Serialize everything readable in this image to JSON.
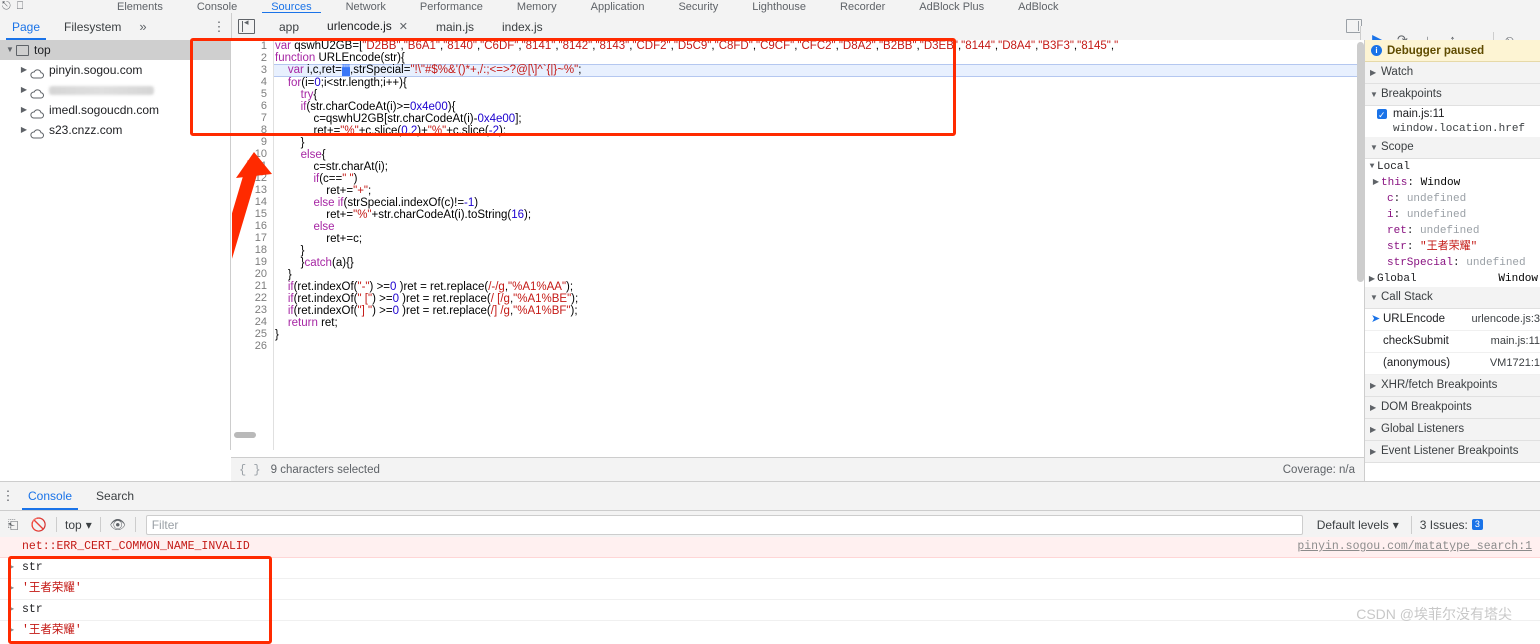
{
  "devtools": {
    "main_tabs": [
      {
        "label": "Elements",
        "active": false
      },
      {
        "label": "Console",
        "active": false
      },
      {
        "label": "Sources",
        "active": true
      },
      {
        "label": "Network",
        "active": false
      },
      {
        "label": "Performance",
        "active": false
      },
      {
        "label": "Memory",
        "active": false
      },
      {
        "label": "Application",
        "active": false
      },
      {
        "label": "Security",
        "active": false
      },
      {
        "label": "Lighthouse",
        "active": false
      },
      {
        "label": "Recorder",
        "active": false
      },
      {
        "label": "AdBlock Plus",
        "active": false
      },
      {
        "label": "AdBlock",
        "active": false
      }
    ],
    "left_icons": [
      "inspect-icon",
      "device-toolbar-icon"
    ]
  },
  "navigator": {
    "tabs": [
      {
        "label": "Page",
        "active": true
      },
      {
        "label": "Filesystem",
        "active": false
      }
    ],
    "more_label": "»",
    "menu_icon": "kebab-menu-icon",
    "tree": [
      {
        "label": "top",
        "icon": "frame-icon",
        "depth": 0,
        "selected": true,
        "expanded": true,
        "blurred": false
      },
      {
        "label": "pinyin.sogou.com",
        "icon": "cloud-icon",
        "depth": 1,
        "selected": false,
        "expanded": false,
        "blurred": false
      },
      {
        "label": "",
        "icon": "cloud-icon",
        "depth": 1,
        "selected": false,
        "expanded": false,
        "blurred": true
      },
      {
        "label": "imedl.sogoucdn.com",
        "icon": "cloud-icon",
        "depth": 1,
        "selected": false,
        "expanded": false,
        "blurred": false
      },
      {
        "label": "s23.cnzz.com",
        "icon": "cloud-icon",
        "depth": 1,
        "selected": false,
        "expanded": false,
        "blurred": false
      }
    ]
  },
  "editor_tabs": {
    "panel_toggle_icon": "show-navigator-icon",
    "items": [
      {
        "label": "app",
        "active": false,
        "closable": false
      },
      {
        "label": "urlencode.js",
        "active": true,
        "closable": true,
        "close_label": "✕"
      },
      {
        "label": "main.js",
        "active": false,
        "closable": false
      },
      {
        "label": "index.js",
        "active": false,
        "closable": false
      }
    ]
  },
  "debug_toolbar": {
    "buttons": [
      {
        "name": "resume-script-execution",
        "glyph": "▶"
      },
      {
        "name": "step-over-next-function-call",
        "glyph": "↷"
      },
      {
        "name": "step-into-next-function-call",
        "glyph": "↓"
      },
      {
        "name": "step-out-of-current-function",
        "glyph": "↑"
      },
      {
        "name": "step",
        "glyph": "→"
      },
      {
        "name": "deactivate-breakpoints",
        "glyph": "⦸"
      }
    ]
  },
  "code": {
    "file": "urlencode.js",
    "highlighted_line": 3,
    "selection": "\"\"",
    "lines": [
      {
        "n": 1,
        "text": "var qswhU2GB=[\"D2BB\",\"B6A1\",\"8140\",\"C6DF\",\"8141\",\"8142\",\"8143\",\"CDF2\",\"D5C9\",\"C8FD\",\"C9CF\",\"CFC2\",\"D8A2\",\"B2BB\",\"D3EB\",\"8144\",\"D8A4\",\"B3F3\",\"8145\",\""
      },
      {
        "n": 2,
        "text": "function URLEncode(str){"
      },
      {
        "n": 3,
        "text": "    var i,c,ret=\"\",strSpecial=\"!\\\"#$%&'()*+,/:;<=>?@[\\]^`{|}~%\";"
      },
      {
        "n": 4,
        "text": "    for(i=0;i<str.length;i++){"
      },
      {
        "n": 5,
        "text": "        try{"
      },
      {
        "n": 6,
        "text": "        if(str.charCodeAt(i)>=0x4e00){"
      },
      {
        "n": 7,
        "text": "            c=qswhU2GB[str.charCodeAt(i)-0x4e00];"
      },
      {
        "n": 8,
        "text": "            ret+=\"%\"+c.slice(0,2)+\"%\"+c.slice(-2);"
      },
      {
        "n": 9,
        "text": "        }"
      },
      {
        "n": 10,
        "text": "        else{"
      },
      {
        "n": 11,
        "text": "            c=str.charAt(i);"
      },
      {
        "n": 12,
        "text": "            if(c==\" \")"
      },
      {
        "n": 13,
        "text": "                ret+=\"+\";"
      },
      {
        "n": 14,
        "text": "            else if(strSpecial.indexOf(c)!=-1)"
      },
      {
        "n": 15,
        "text": "                ret+=\"%\"+str.charCodeAt(i).toString(16);"
      },
      {
        "n": 16,
        "text": "            else"
      },
      {
        "n": 17,
        "text": "                ret+=c;"
      },
      {
        "n": 18,
        "text": "        }"
      },
      {
        "n": 19,
        "text": "        }catch(a){}"
      },
      {
        "n": 20,
        "text": "    }"
      },
      {
        "n": 21,
        "text": "    if(ret.indexOf(\"-\") >=0 )ret = ret.replace(/-/g,\"%A1%AA\");"
      },
      {
        "n": 22,
        "text": "    if(ret.indexOf(\" [\") >=0 )ret = ret.replace(/ [/g,\"%A1%BE\");"
      },
      {
        "n": 23,
        "text": "    if(ret.indexOf(\"] \") >=0 )ret = ret.replace(/] /g,\"%A1%BF\");"
      },
      {
        "n": 24,
        "text": "    return ret;"
      },
      {
        "n": 25,
        "text": "}"
      },
      {
        "n": 26,
        "text": ""
      }
    ]
  },
  "editor_status": {
    "pretty_print_icon": "{ }",
    "selection_text": "9 characters selected",
    "coverage_text": "Coverage: n/a"
  },
  "debug_sidebar": {
    "paused_banner": "Debugger paused",
    "watch": {
      "title": "Watch",
      "expanded": false
    },
    "breakpoints": {
      "title": "Breakpoints",
      "expanded": true,
      "items": [
        {
          "location": "main.js:11",
          "source": "window.location.href",
          "checked": true
        }
      ]
    },
    "scope": {
      "title": "Scope",
      "expanded": true,
      "local_label": "Local",
      "vars": [
        {
          "name": "this",
          "value": "Window",
          "kind": "object",
          "expandable": true
        },
        {
          "name": "c",
          "value": "undefined",
          "kind": "undefined",
          "expandable": false
        },
        {
          "name": "i",
          "value": "undefined",
          "kind": "undefined",
          "expandable": false
        },
        {
          "name": "ret",
          "value": "undefined",
          "kind": "undefined",
          "expandable": false
        },
        {
          "name": "str",
          "value": "\"王者荣耀\"",
          "kind": "string",
          "expandable": false
        },
        {
          "name": "strSpecial",
          "value": "undefined",
          "kind": "undefined",
          "expandable": false
        }
      ],
      "global_label": "Global",
      "global_value": "Window"
    },
    "call_stack": {
      "title": "Call Stack",
      "expanded": true,
      "frames": [
        {
          "fn": "URLEncode",
          "loc": "urlencode.js:3",
          "current": true
        },
        {
          "fn": "checkSubmit",
          "loc": "main.js:11",
          "current": false
        },
        {
          "fn": "(anonymous)",
          "loc": "VM1721:1",
          "current": false
        }
      ]
    },
    "sections": [
      {
        "title": "XHR/fetch Breakpoints",
        "expanded": false
      },
      {
        "title": "DOM Breakpoints",
        "expanded": false
      },
      {
        "title": "Global Listeners",
        "expanded": false
      },
      {
        "title": "Event Listener Breakpoints",
        "expanded": false
      }
    ]
  },
  "drawer": {
    "menu_icon": "kebab-menu-icon",
    "tabs": [
      {
        "label": "Console",
        "active": true
      },
      {
        "label": "Search",
        "active": false
      }
    ],
    "toolbar": {
      "sidebar_toggle_icon": "console-sidebar-icon",
      "clear_icon": "clear-console-icon",
      "context": "top",
      "context_caret": "▾",
      "eye_icon": "live-expression-icon",
      "filter_placeholder": "Filter",
      "levels_label": "Default levels",
      "levels_caret": "▾",
      "issues_label": "3 Issues:",
      "issues_count": "3"
    },
    "messages": [
      {
        "text": "net::ERR_CERT_COMMON_NAME_INVALID",
        "type": "error",
        "link": "pinyin.sogou.com/matatype_search:1"
      },
      {
        "text": "str",
        "type": "log",
        "expandable": true
      },
      {
        "text": "'王者荣耀'",
        "type": "value",
        "expandable": true
      },
      {
        "text": "str",
        "type": "log",
        "expandable": true
      },
      {
        "text": "'王者荣耀'",
        "type": "value",
        "expandable": true
      }
    ]
  },
  "annotations": {
    "code_box": "red-rectangle-highlight-code",
    "console_box": "red-rectangle-highlight-console",
    "arrow": "red-arrow"
  },
  "watermark": "CSDN @埃菲尔没有塔尖",
  "colors": {
    "accent": "#1a73e8",
    "error": "#c41a16",
    "paused_bg": "#fdf4d3",
    "annotation": "#ff2a00",
    "selection": "#3a77f7"
  }
}
